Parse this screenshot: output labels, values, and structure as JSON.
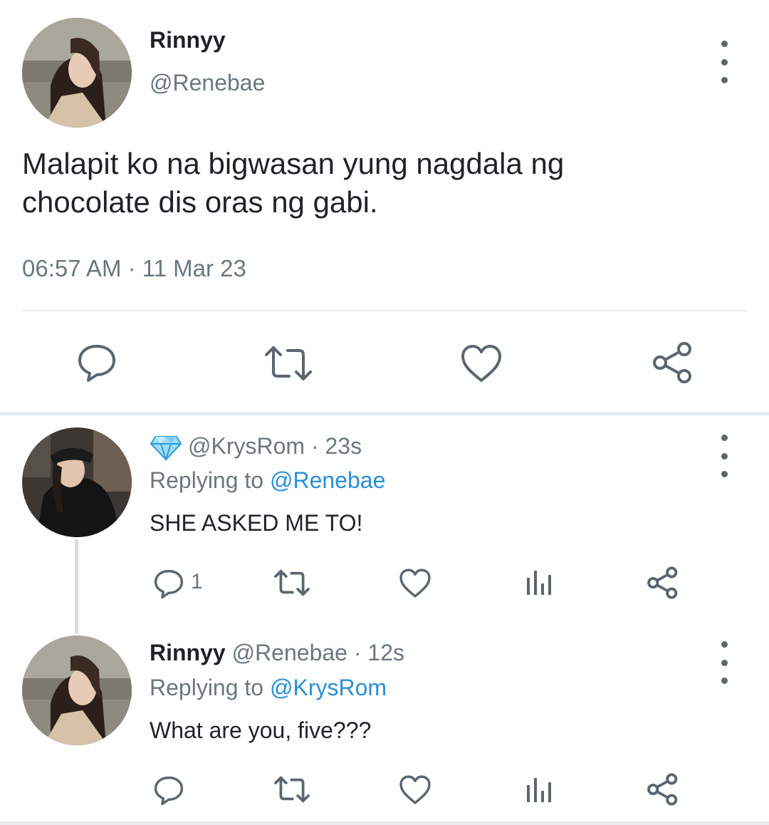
{
  "main_tweet": {
    "author_name": "Rinnyy",
    "handle": "@Renebae",
    "text_line1": "Malapit ko na bigwasan yung nagdala ng",
    "text_line2": "chocolate dis oras ng gabi.",
    "timestamp": "06:57 AM · 11 Mar 23",
    "actions": [
      "reply-icon",
      "retweet-icon",
      "like-icon",
      "share-icon"
    ]
  },
  "replies": [
    {
      "badge_icon": "diamond-icon",
      "handle": "@KrysRom",
      "time": "· 23s",
      "replying_prefix": "Replying to",
      "replying_to": "@Renebae",
      "text": "SHE ASKED ME TO!",
      "reply_count": "1"
    },
    {
      "author_name": "Rinnyy",
      "handle": "@Renebae",
      "time": "· 12s",
      "replying_prefix": "Replying to",
      "replying_to": "@KrysRom",
      "text": "What are you, five???"
    }
  ],
  "colors": {
    "text": "#1f2328",
    "muted": "#6b7780",
    "link": "#2a8fd6",
    "icon": "#5b6670",
    "divider": "#e9ecee"
  }
}
